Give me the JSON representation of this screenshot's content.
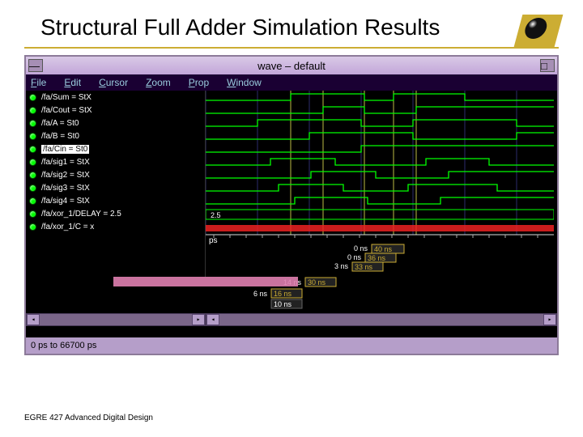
{
  "slide": {
    "title": "Structural Full Adder Simulation Results",
    "footer": "EGRE 427 Advanced Digital Design"
  },
  "window": {
    "title": "wave – default",
    "status": "0 ps to 66700 ps"
  },
  "menu": {
    "file": "File",
    "edit": "Edit",
    "cursor": "Cursor",
    "zoom": "Zoom",
    "prop": "Prop",
    "window": "Window"
  },
  "signals": [
    {
      "label": "/fa/Sum = StX"
    },
    {
      "label": "/fa/Cout = StX"
    },
    {
      "label": "/fa/A = St0"
    },
    {
      "label": "/fa/B = St0"
    },
    {
      "label": "/fa/Cin = St0",
      "highlight": true
    },
    {
      "label": "/fa/sig1 = StX"
    },
    {
      "label": "/fa/sig2 = StX"
    },
    {
      "label": "/fa/sig3 = StX"
    },
    {
      "label": "/fa/sig4 = StX"
    },
    {
      "label": "/fa/xor_1/DELAY = 2.5"
    },
    {
      "label": "/fa/xor_1/C = x"
    }
  ],
  "cursors": {
    "unit": "ps",
    "rows": [
      {
        "ref": "0 ns",
        "val": "40 ns"
      },
      {
        "ref": "0 ns",
        "val": "36 ns"
      },
      {
        "ref": "3 ns",
        "val": "33 ns"
      },
      {
        "ref": "14 ns",
        "val": "30 ns"
      },
      {
        "ref": "6 ns",
        "val": "16 ns"
      },
      {
        "ref": "10 ns",
        "val": ""
      }
    ]
  },
  "delay_label": "2.5"
}
